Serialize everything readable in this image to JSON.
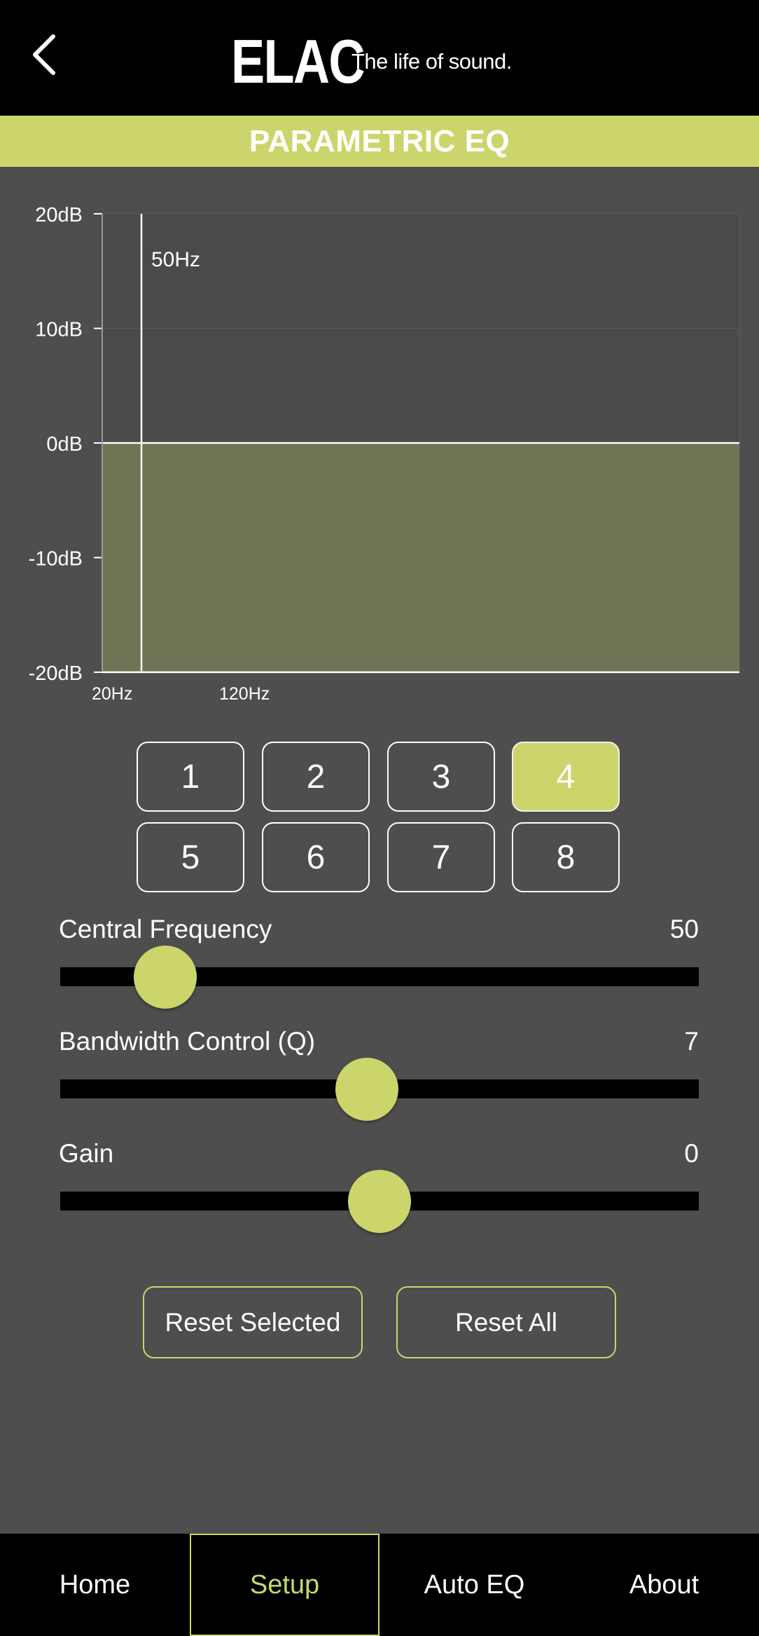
{
  "header": {
    "logo_mark": "ELAC",
    "tagline": "The life of sound."
  },
  "title": "PARAMETRIC EQ",
  "chart_data": {
    "type": "area",
    "title": "",
    "xlabel": "",
    "ylabel": "",
    "ylim": [
      -20,
      20
    ],
    "y_ticks": [
      "20dB",
      "10dB",
      "0dB",
      "-10dB",
      "-20dB"
    ],
    "x_tick_labels": [
      "20Hz",
      "120Hz"
    ],
    "series": [
      {
        "values": [
          0,
          0
        ]
      }
    ],
    "marker_label": "50Hz",
    "fill_color": "#6e7555",
    "grid": true
  },
  "bands": {
    "labels": [
      "1",
      "2",
      "3",
      "4",
      "5",
      "6",
      "7",
      "8"
    ],
    "selected": "4"
  },
  "sliders": {
    "frequency": {
      "label": "Central Frequency",
      "value": "50",
      "fraction": 0.165
    },
    "bandwidth": {
      "label": "Bandwidth Control (Q)",
      "value": "7",
      "fraction": 0.48
    },
    "gain": {
      "label": "Gain",
      "value": "0",
      "fraction": 0.5
    }
  },
  "buttons": {
    "reset_selected": "Reset Selected",
    "reset_all": "Reset All"
  },
  "nav": {
    "items": [
      "Home",
      "Setup",
      "Auto EQ",
      "About"
    ],
    "active": "Setup"
  },
  "colors": {
    "accent": "#cbd56b",
    "background": "#4e4e4e",
    "bar": "#000000"
  }
}
